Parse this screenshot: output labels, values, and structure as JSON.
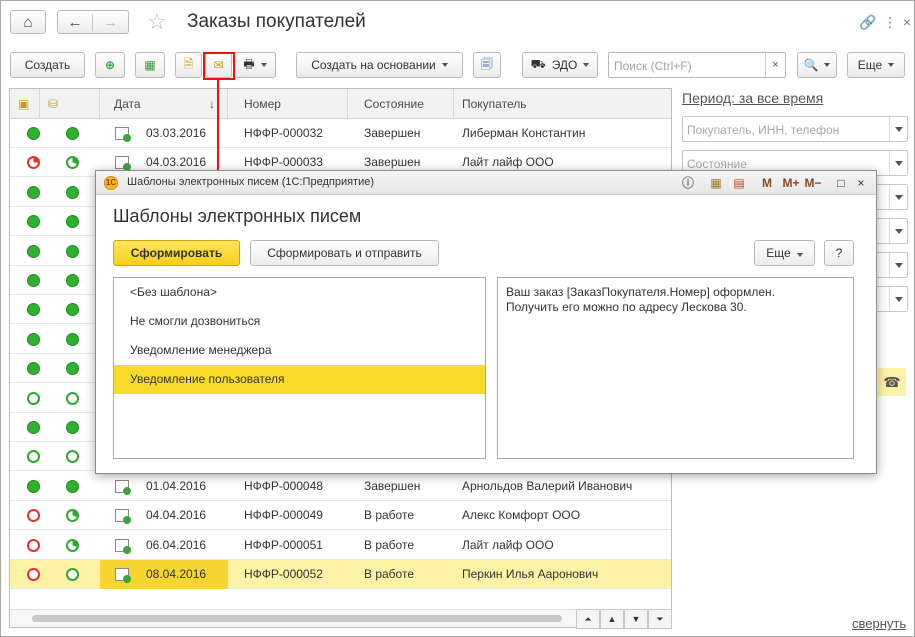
{
  "window": {
    "title": "Заказы покупателей"
  },
  "toolbar": {
    "create_label": "Создать",
    "create_based_label": "Создать на основании",
    "edo_label": "ЭДО",
    "search_placeholder": "Поиск (Ctrl+F)",
    "search_clear": "×",
    "more_label": "Еще"
  },
  "table": {
    "headers": {
      "date": "Дата",
      "sort_arrow": "↓",
      "number": "Номер",
      "state": "Состояние",
      "customer": "Покупатель"
    },
    "rows": [
      {
        "date": "03.03.2016",
        "number": "НФФР-000032",
        "state": "Завершен",
        "customer": "Либерман Константин",
        "s1": "full",
        "s2": "full"
      },
      {
        "date": "04.03.2016",
        "number": "НФФР-000033",
        "state": "Завершен",
        "customer": "Лайт лайф ООО",
        "s1": "redpie",
        "s2": "greenpie"
      },
      {
        "date": "",
        "number": "",
        "state": "",
        "customer": "",
        "s1": "full",
        "s2": "full"
      },
      {
        "date": "",
        "number": "",
        "state": "",
        "customer": "",
        "s1": "full",
        "s2": "full"
      },
      {
        "date": "",
        "number": "",
        "state": "",
        "customer": "",
        "s1": "full",
        "s2": "full"
      },
      {
        "date": "",
        "number": "",
        "state": "",
        "customer": "",
        "s1": "full",
        "s2": "full"
      },
      {
        "date": "",
        "number": "",
        "state": "",
        "customer": "",
        "s1": "full",
        "s2": "full"
      },
      {
        "date": "",
        "number": "",
        "state": "",
        "customer": "",
        "s1": "full",
        "s2": "full"
      },
      {
        "date": "",
        "number": "",
        "state": "",
        "customer": "",
        "s1": "full",
        "s2": "full"
      },
      {
        "date": "",
        "number": "",
        "state": "",
        "customer": "",
        "s1": "ring",
        "s2": "ring"
      },
      {
        "date": "",
        "number": "",
        "state": "",
        "customer": "",
        "s1": "full",
        "s2": "full"
      },
      {
        "date": "",
        "number": "",
        "state": "",
        "customer": "",
        "s1": "ring",
        "s2": "ring"
      },
      {
        "date": "01.04.2016",
        "number": "НФФР-000048",
        "state": "Завершен",
        "customer": "Арнольдов Валерий Иванович",
        "s1": "full",
        "s2": "full"
      },
      {
        "date": "04.04.2016",
        "number": "НФФР-000049",
        "state": "В работе",
        "customer": "Алекс Комфорт ООО",
        "s1": "red",
        "s2": "greenpie"
      },
      {
        "date": "06.04.2016",
        "number": "НФФР-000051",
        "state": "В работе",
        "customer": "Лайт лайф ООО",
        "s1": "red",
        "s2": "greenpie"
      },
      {
        "date": "08.04.2016",
        "number": "НФФР-000052",
        "state": "В работе",
        "customer": "Перкин Илья Аaронович",
        "s1": "red",
        "s2": "ring",
        "selected": true
      }
    ]
  },
  "filters": {
    "period_label": "Период: за все время",
    "customer_placeholder": "Покупатель, ИНН, телефон",
    "state_placeholder": "Состояние"
  },
  "footer": {
    "collapse_label": "свернуть"
  },
  "dialog": {
    "window_title": "Шаблоны электронных писем  (1С:Предприятие)",
    "heading": "Шаблоны электронных писем",
    "generate_label": "Сформировать",
    "generate_send_label": "Сформировать и отправить",
    "more_label": "Еще",
    "help_label": "?",
    "title_icons": [
      "M",
      "M+",
      "M−"
    ],
    "templates": [
      {
        "label": "<Без шаблона>"
      },
      {
        "label": "Не смогли дозвониться"
      },
      {
        "label": "Уведомление менеджера"
      },
      {
        "label": "Уведомление пользователя",
        "selected": true
      }
    ],
    "preview_line1": "Ваш заказ [ЗаказПокупателя.Номер] оформлен.",
    "preview_line2": "Получить его можно по адресу Лескова 30."
  },
  "colors": {
    "accent_yellow": "#f9dc2a",
    "selection_row": "#fdf2a6",
    "status_green": "#2fb12f",
    "status_red": "#e0352b",
    "annotation_red": "#ee1111"
  }
}
